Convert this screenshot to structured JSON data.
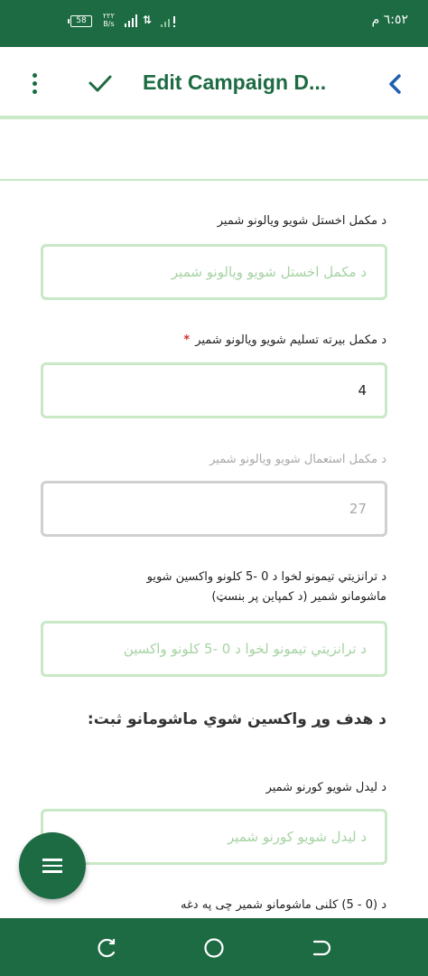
{
  "status_bar": {
    "time": "٦:٥٢ م",
    "battery": "58",
    "net_speed": "٢٢٢",
    "net_unit": "B/s"
  },
  "app_bar": {
    "title": "Edit Campaign D...",
    "icons": {
      "menu": "more-vertical-icon",
      "confirm": "check-icon",
      "back": "chevron-left-icon"
    },
    "accent_color": "#1d6b43"
  },
  "form": {
    "fields": [
      {
        "label": "د مکمل اخستل شویو ویالونو شمیر",
        "placeholder": "د مکمل اخستل شویو ویالونو شمیر",
        "value": "",
        "required": false,
        "disabled": false
      },
      {
        "label": "د مکمل بیرته تسلیم شویو ویالونو شمیر",
        "placeholder": "",
        "value": "4",
        "required": true,
        "disabled": false
      },
      {
        "label": "د مکمل استعمال شویو ویالونو شمیر",
        "placeholder": "",
        "value": "27",
        "required": false,
        "disabled": true
      },
      {
        "label": "د ترانزیتي تیمونو لخوا د 0 -5 کلونو واکسین شویو ماشومانو شمیر (د کمپاین پر بنسټ)",
        "placeholder": "د ترانزیتي تیمونو لخوا د 0 -5 کلونو واکسین",
        "value": "",
        "required": false,
        "disabled": false
      },
      {
        "label": "د لیدل شویو کورنو شمیر",
        "placeholder": "د لیدل شویو کورنو شمیر",
        "value": "",
        "required": false,
        "disabled": false
      },
      {
        "label": "د (0 - 5) کلنی ماشومانو شمیر چی په دغه",
        "placeholder": "",
        "value": "",
        "required": false,
        "disabled": false
      }
    ],
    "section_heading": "د هدف وړ واکسین شوي ماشومانو ثبت:",
    "required_marker": "*"
  },
  "fab": {
    "icon": "hamburger-menu-icon"
  },
  "nav_bar": {
    "icons": [
      "recent-apps-icon",
      "home-icon",
      "back-icon"
    ]
  },
  "colors": {
    "primary": "#1d6b43",
    "field_border": "#c8e8c6",
    "placeholder": "#a6d3a3",
    "disabled_border": "#d0d0d0",
    "required": "#d32f2f"
  }
}
